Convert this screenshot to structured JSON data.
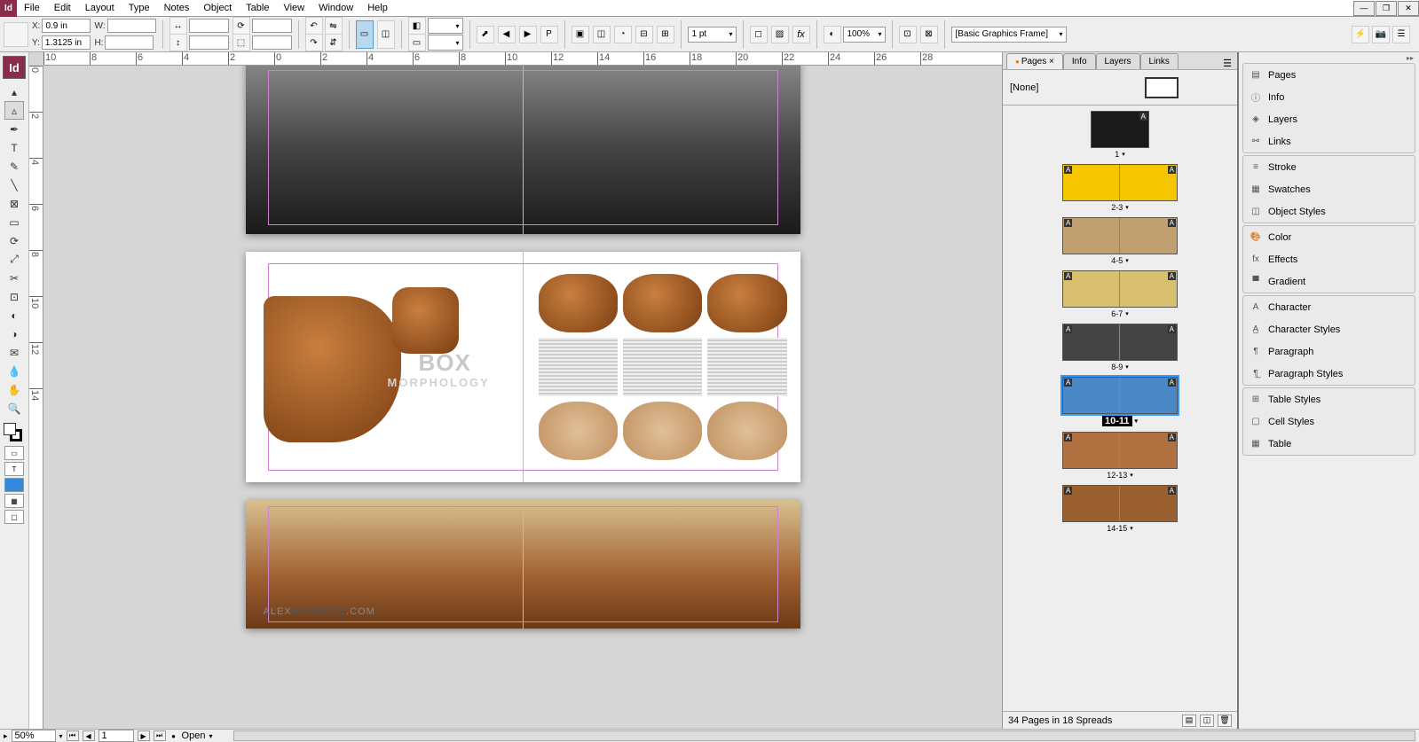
{
  "menu": {
    "items": [
      "File",
      "Edit",
      "Layout",
      "Type",
      "Notes",
      "Object",
      "Table",
      "View",
      "Window",
      "Help"
    ]
  },
  "winbtns": {
    "min": "—",
    "restore": "❐",
    "close": "✕"
  },
  "control": {
    "x_label": "X:",
    "x": "0.9 in",
    "y_label": "Y:",
    "y": "1.3125 in",
    "w_label": "W:",
    "w": "",
    "h_label": "H:",
    "h": "",
    "stroke": "1 pt",
    "zoom": "100%",
    "style": "[Basic Graphics Frame]"
  },
  "pages_panel": {
    "tabs": [
      "Pages",
      "Info",
      "Layers",
      "Links"
    ],
    "master": "[None]",
    "spreads": [
      {
        "label": "1",
        "pages": 1,
        "color": "#1a1a1a"
      },
      {
        "label": "2-3",
        "pages": 2,
        "color": "#f5c500"
      },
      {
        "label": "4-5",
        "pages": 2,
        "color": "#c0a070"
      },
      {
        "label": "6-7",
        "pages": 2,
        "color": "#d9c070"
      },
      {
        "label": "8-9",
        "pages": 2,
        "color": "#444"
      },
      {
        "label": "10-11",
        "pages": 2,
        "color": "#4a88c8",
        "selected": true
      },
      {
        "label": "12-13",
        "pages": 2,
        "color": "#b07040"
      },
      {
        "label": "14-15",
        "pages": 2,
        "color": "#9a6030"
      }
    ],
    "status": "34 Pages in 18 Spreads"
  },
  "dock": {
    "groups": [
      [
        "Pages",
        "Info",
        "Layers",
        "Links"
      ],
      [
        "Stroke",
        "Swatches",
        "Object Styles"
      ],
      [
        "Color",
        "Effects",
        "Gradient"
      ],
      [
        "Character",
        "Character Styles",
        "Paragraph",
        "Paragraph Styles"
      ],
      [
        "Table Styles",
        "Cell Styles",
        "Table"
      ]
    ],
    "icons": {
      "Pages": "▤",
      "Info": "ⓘ",
      "Layers": "◈",
      "Links": "⚯",
      "Stroke": "≡",
      "Swatches": "▦",
      "Object Styles": "◫",
      "Color": "🎨",
      "Effects": "fx",
      "Gradient": "▀",
      "Character": "A",
      "Character Styles": "A̲",
      "Paragraph": "¶",
      "Paragraph Styles": "¶̲",
      "Table Styles": "⊞",
      "Cell Styles": "▢",
      "Table": "▦"
    }
  },
  "canvas": {
    "box_title": "BOX",
    "box_sub": "MORPHOLOGY",
    "watermark_1": "ALEX",
    "watermark_2": "HOGREFE",
    "watermark_3": ".COM"
  },
  "status": {
    "zoom": "50%",
    "page": "1",
    "open": "Open"
  },
  "ruler_h": [
    -10,
    -8,
    -6,
    -4,
    -2,
    0,
    2,
    4,
    6,
    8,
    10,
    12,
    14,
    16,
    18,
    20,
    22,
    24,
    26,
    28
  ],
  "ruler_v": [
    0,
    2,
    4,
    6,
    8,
    10,
    12,
    14
  ]
}
